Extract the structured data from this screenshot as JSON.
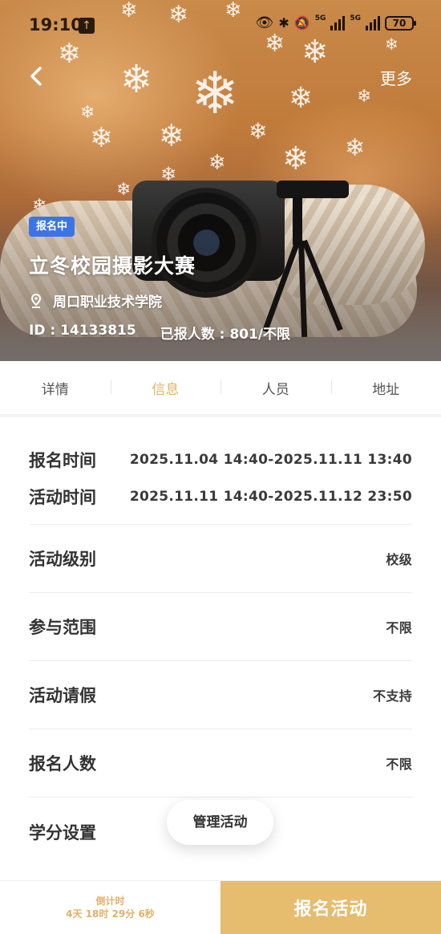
{
  "statusbar": {
    "time": "19:10",
    "network_1": "5G",
    "network_2": "5G",
    "battery": "70"
  },
  "header": {
    "more_label": "更多"
  },
  "event": {
    "status_badge": "报名中",
    "title": "立冬校园摄影大赛",
    "location": "周口职业技术学院",
    "id_text": "ID : 14133815",
    "enrolled_text": "已报人数 : 801/不限"
  },
  "tabs": [
    {
      "label": "详情",
      "active": false
    },
    {
      "label": "信息",
      "active": true
    },
    {
      "label": "人员",
      "active": false
    },
    {
      "label": "地址",
      "active": false
    }
  ],
  "info": {
    "signup_time_label": "报名时间",
    "signup_time_value": "2025.11.04 14:40-2025.11.11 13:40",
    "activity_time_label": "活动时间",
    "activity_time_value": "2025.11.11 14:40-2025.11.12 23:50",
    "rows": [
      {
        "label": "活动级别",
        "value": "校级"
      },
      {
        "label": "参与范围",
        "value": "不限"
      },
      {
        "label": "活动请假",
        "value": "不支持"
      },
      {
        "label": "报名人数",
        "value": "不限"
      },
      {
        "label": "学分设置",
        "value": ""
      }
    ]
  },
  "manage_button": "管理活动",
  "bottom": {
    "countdown_title": "倒计时",
    "countdown_value": "4天 18时 29分 6秒",
    "signup_button": "报名活动"
  },
  "colors": {
    "accent": "#e6bc6f",
    "badge": "#3b74e6",
    "active_tab": "#e2b165"
  }
}
